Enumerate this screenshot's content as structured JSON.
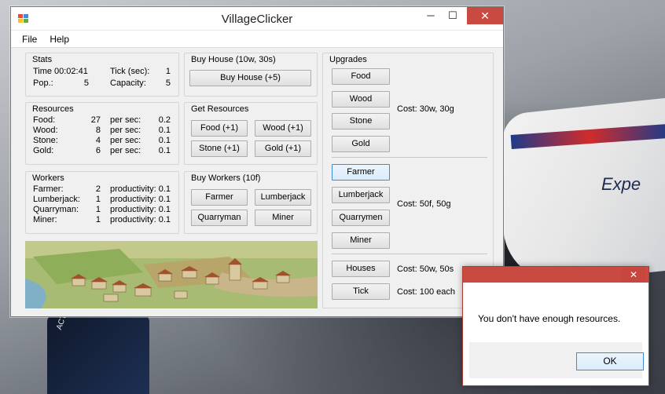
{
  "window": {
    "title": "VillageClicker"
  },
  "titlebar": {
    "min_glyph": "─",
    "max_glyph": "☐",
    "close_glyph": "✕"
  },
  "menu": {
    "items": [
      "File",
      "Help"
    ]
  },
  "stats": {
    "title": "Stats",
    "time_label": "Time",
    "time_value": "00:02:41",
    "tick_label": "Tick (sec):",
    "tick_value": "1",
    "pop_label": "Pop.:",
    "pop_value": "5",
    "capacity_label": "Capacity:",
    "capacity_value": "5"
  },
  "buy_house": {
    "title": "Buy House (10w, 30s)",
    "button": "Buy House (+5)"
  },
  "resources": {
    "title": "Resources",
    "per_sec_label": "per sec:",
    "rows": [
      {
        "name": "Food:",
        "amount": "27",
        "rate": "0.2"
      },
      {
        "name": "Wood:",
        "amount": "8",
        "rate": "0.1"
      },
      {
        "name": "Stone:",
        "amount": "4",
        "rate": "0.1"
      },
      {
        "name": "Gold:",
        "amount": "6",
        "rate": "0.1"
      }
    ]
  },
  "get_resources": {
    "title": "Get Resources",
    "buttons": [
      "Food (+1)",
      "Wood (+1)",
      "Stone (+1)",
      "Gold (+1)"
    ]
  },
  "workers": {
    "title": "Workers",
    "productivity_label": "productivity:",
    "rows": [
      {
        "name": "Farmer:",
        "count": "2",
        "productivity": "0.1"
      },
      {
        "name": "Lumberjack:",
        "count": "1",
        "productivity": "0.1"
      },
      {
        "name": "Quarryman:",
        "count": "1",
        "productivity": "0.1"
      },
      {
        "name": "Miner:",
        "count": "1",
        "productivity": "0.1"
      }
    ]
  },
  "buy_workers": {
    "title": "Buy Workers (10f)",
    "buttons": [
      "Farmer",
      "Lumberjack",
      "Quarryman",
      "Miner"
    ]
  },
  "upgrades": {
    "title": "Upgrades",
    "resource_buttons": [
      "Food",
      "Wood",
      "Stone",
      "Gold"
    ],
    "resource_cost": "Cost: 30w, 30g",
    "worker_buttons": [
      "Farmer",
      "Lumberjack",
      "Quarrymen",
      "Miner"
    ],
    "worker_cost": "Cost: 50f, 50g",
    "houses_button": "Houses",
    "houses_cost": "Cost: 50w, 50s",
    "tick_button": "Tick",
    "tick_cost": "Cost: 100 each"
  },
  "dialog": {
    "close_glyph": "✕",
    "message": "You don't have enough resources.",
    "ok_label": "OK"
  },
  "desktop": {
    "car_text": "Expe",
    "bottom_text": "ACTION ROAD SAFETY"
  },
  "colors": {
    "window_bg": "#f0f0f0",
    "close_red": "#c84a40",
    "focus_blue": "#3c8bd9"
  }
}
